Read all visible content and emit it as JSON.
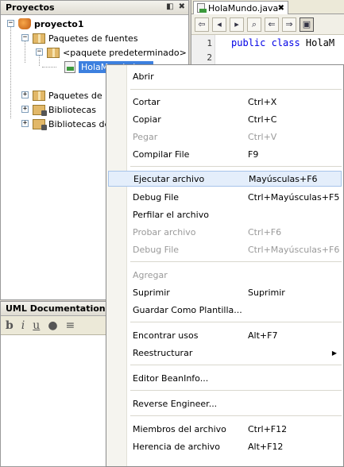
{
  "projects": {
    "title": "Proyectos",
    "tree": {
      "project": "proyecto1",
      "source_packages": "Paquetes de fuentes",
      "default_package": "<paquete predeterminado>",
      "file": "HolaMundo.java",
      "test_packages": "Paquetes de p",
      "libraries": "Bibliotecas",
      "test_libraries": "Bibliotecas de"
    }
  },
  "uml": {
    "title": "UML Documentation"
  },
  "editor": {
    "tab_label": "HolaMundo.java",
    "line_numbers": [
      "1",
      "2"
    ],
    "code_line_1_keywords": "public class",
    "code_line_1_rest": " HolaM"
  },
  "context_menu": {
    "items": [
      {
        "label": "Abrir",
        "shortcut": "",
        "disabled": false
      },
      {
        "label": "Cortar",
        "shortcut": "Ctrl+X",
        "disabled": false
      },
      {
        "label": "Copiar",
        "shortcut": "Ctrl+C",
        "disabled": false
      },
      {
        "label": "Pegar",
        "shortcut": "Ctrl+V",
        "disabled": true
      },
      {
        "label": "Compilar File",
        "shortcut": "F9",
        "disabled": false
      },
      {
        "label": "Ejecutar archivo",
        "shortcut": "Mayúsculas+F6",
        "disabled": false,
        "highlighted": true
      },
      {
        "label": "Debug File",
        "shortcut": "Ctrl+Mayúsculas+F5",
        "disabled": false
      },
      {
        "label": "Perfilar el archivo",
        "shortcut": "",
        "disabled": false
      },
      {
        "label": "Probar archivo",
        "shortcut": "Ctrl+F6",
        "disabled": true
      },
      {
        "label": "Debug File",
        "shortcut": "Ctrl+Mayúsculas+F6",
        "disabled": true
      },
      {
        "label": "Agregar",
        "shortcut": "",
        "disabled": true
      },
      {
        "label": "Suprimir",
        "shortcut": "Suprimir",
        "disabled": false
      },
      {
        "label": "Guardar Como Plantilla...",
        "shortcut": "",
        "disabled": false
      },
      {
        "label": "Encontrar usos",
        "shortcut": "Alt+F7",
        "disabled": false
      },
      {
        "label": "Reestructurar",
        "shortcut": "",
        "disabled": false,
        "submenu": true
      },
      {
        "label": "Editor BeanInfo...",
        "shortcut": "",
        "disabled": false
      },
      {
        "label": "Reverse Engineer...",
        "shortcut": "",
        "disabled": false
      },
      {
        "label": "Miembros del archivo",
        "shortcut": "Ctrl+F12",
        "disabled": false
      },
      {
        "label": "Herencia de archivo",
        "shortcut": "Alt+F12",
        "disabled": false
      }
    ]
  }
}
